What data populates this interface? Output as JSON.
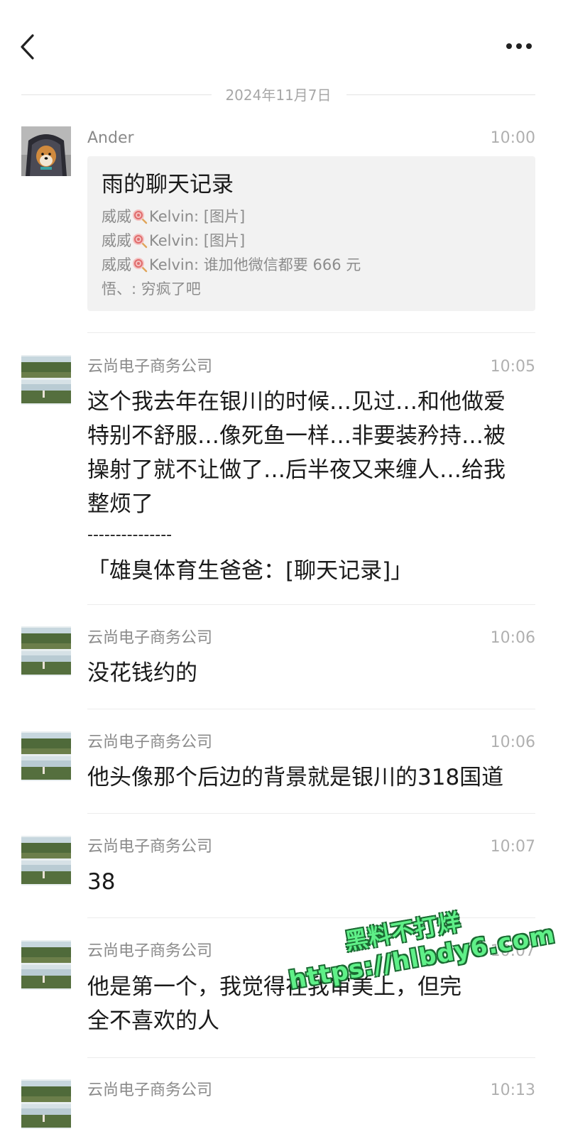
{
  "date_divider": "2024年11月7日",
  "card_message": {
    "sender": "Ander",
    "time": "10:00",
    "card_title": "雨的聊天记录",
    "lines": [
      {
        "name": "威威",
        "rest": "Kelvin: [图片]"
      },
      {
        "name": "威威",
        "rest": "Kelvin: [图片]"
      },
      {
        "name": "威威",
        "rest": "Kelvin: 谁加他微信都要 666 元"
      },
      {
        "name": "",
        "rest": "悟、: 穷疯了吧"
      }
    ]
  },
  "messages": [
    {
      "sender": "云尚电子商务公司",
      "time": "10:05",
      "lines": [
        "这个我去年在银川的时候…见过…和他做爱",
        "特别不舒服…像死鱼一样…非要装矜持…被",
        "操射了就不让做了…后半夜又来缠人…给我",
        "整烦了",
        "---------------",
        "「雄臭体育生爸爸：[聊天记录]」"
      ]
    },
    {
      "sender": "云尚电子商务公司",
      "time": "10:06",
      "lines": [
        "没花钱约的"
      ]
    },
    {
      "sender": "云尚电子商务公司",
      "time": "10:06",
      "lines": [
        "他头像那个后边的背景就是银川的318国道"
      ]
    },
    {
      "sender": "云尚电子商务公司",
      "time": "10:07",
      "lines": [
        "38"
      ]
    },
    {
      "sender": "云尚电子商务公司",
      "time": "10:07",
      "lines": [
        "他是第一个，我觉得在我审美上，但完",
        "全不喜欢的人"
      ]
    },
    {
      "sender": "云尚电子商务公司",
      "time": "10:13",
      "lines": []
    }
  ],
  "watermark": {
    "line1": "黑料不打烊",
    "line2": "https://hlbdy6.com"
  },
  "icons": {
    "back": "chevron-left-icon",
    "more": "more-dots-icon"
  },
  "colors": {
    "card_bg": "#f2f2f2",
    "watermark_green": "#5ff088"
  }
}
